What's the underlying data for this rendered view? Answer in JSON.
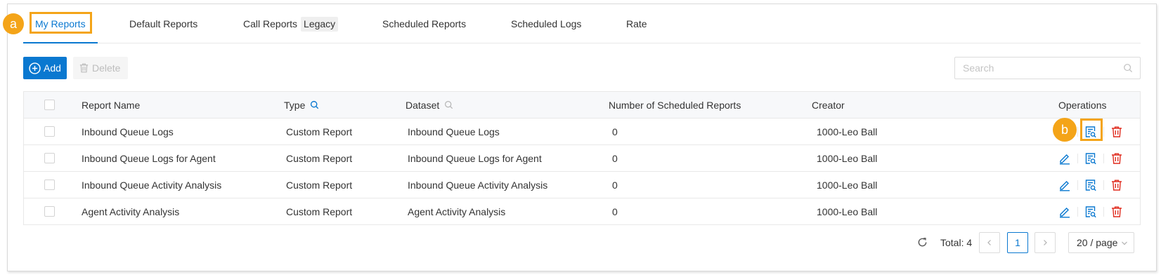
{
  "tabs": [
    {
      "label": "My Reports",
      "active": true
    },
    {
      "label": "Default Reports",
      "active": false
    },
    {
      "label": "Call Reports",
      "badge": "Legacy",
      "active": false
    },
    {
      "label": "Scheduled Reports",
      "active": false
    },
    {
      "label": "Scheduled Logs",
      "active": false
    },
    {
      "label": "Rate",
      "active": false
    }
  ],
  "annotations": [
    {
      "label": "a"
    },
    {
      "label": "b"
    }
  ],
  "toolbar": {
    "add": {
      "label": "Add",
      "icon": "plus-circle-icon"
    },
    "delete": {
      "label": "Delete",
      "icon": "trash-icon",
      "disabled": true
    }
  },
  "search": {
    "placeholder": "Search",
    "value": "",
    "icon": "search-icon"
  },
  "table": {
    "columns": [
      {
        "key": "report_name",
        "label": "Report Name"
      },
      {
        "key": "type",
        "label": "Type",
        "filter_icon": "search-icon",
        "filter_active": true
      },
      {
        "key": "dataset",
        "label": "Dataset",
        "filter_icon": "search-icon",
        "filter_active": false
      },
      {
        "key": "scheduled_reports",
        "label": "Number of Scheduled Reports"
      },
      {
        "key": "creator",
        "label": "Creator"
      },
      {
        "key": "operations",
        "label": "Operations"
      }
    ],
    "operations": [
      "edit-icon",
      "view-report-icon",
      "delete-icon"
    ],
    "rows": [
      {
        "checked": false,
        "report_name": "Inbound Queue Logs",
        "type": "Custom Report",
        "dataset": "Inbound Queue Logs",
        "scheduled_reports": 0,
        "creator": "1000-Leo Ball"
      },
      {
        "checked": false,
        "report_name": "Inbound Queue Logs for Agent",
        "type": "Custom Report",
        "dataset": "Inbound Queue Logs for Agent",
        "scheduled_reports": 0,
        "creator": "1000-Leo Ball"
      },
      {
        "checked": false,
        "report_name": "Inbound Queue Activity Analysis",
        "type": "Custom Report",
        "dataset": "Inbound Queue Activity Analysis",
        "scheduled_reports": 0,
        "creator": "1000-Leo Ball"
      },
      {
        "checked": false,
        "report_name": "Agent Activity Analysis",
        "type": "Custom Report",
        "dataset": "Agent Activity Analysis",
        "scheduled_reports": 0,
        "creator": "1000-Leo Ball"
      }
    ]
  },
  "pagination": {
    "total_label": "Total: 4",
    "current_page": "1",
    "page_size": "20 / page",
    "prev_disabled": true,
    "next_disabled": true
  },
  "colors": {
    "primary": "#0a78d0",
    "danger": "#e02c1f",
    "annotation": "#f4a418",
    "text": "#333333",
    "header_bg": "#f7f8fa",
    "border": "#e8e8e8",
    "disabled_text": "#bdbdbd"
  }
}
